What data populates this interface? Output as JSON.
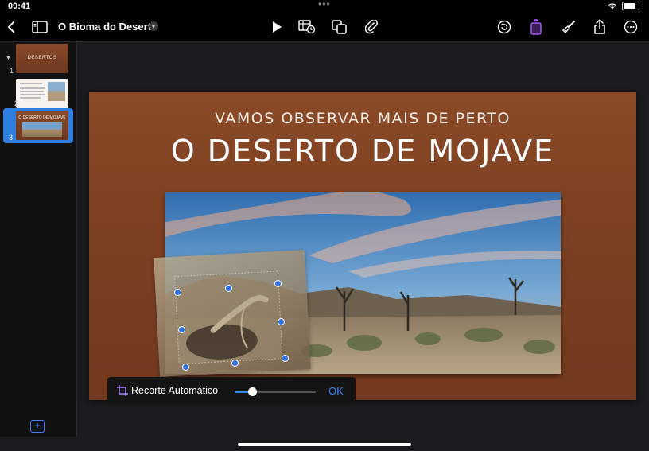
{
  "status_bar": {
    "time": "09:41"
  },
  "toolbar": {
    "doc_title": "O Bioma do Deserto",
    "accent": "#a855f7",
    "icons": [
      "back-icon",
      "sidebar-toggle-icon",
      "title-chevron-icon",
      "play-icon",
      "table-chart-icon",
      "shapes-icon",
      "attachment-icon",
      "undo-icon",
      "format-icon",
      "paintbrush-icon",
      "share-icon",
      "more-icon"
    ]
  },
  "sidebar": {
    "slides": [
      {
        "number": "1",
        "thumb_text": "DESERTOS"
      },
      {
        "number": "2"
      },
      {
        "number": "3",
        "selected": true
      }
    ]
  },
  "slide": {
    "subtitle": "VAMOS OBSERVAR MAIS DE PERTO",
    "title": "O DESERTO DE MOJAVE"
  },
  "crop_bar": {
    "label": "Recorte Automático",
    "ok_label": "OK",
    "slider_value": 0.22
  }
}
